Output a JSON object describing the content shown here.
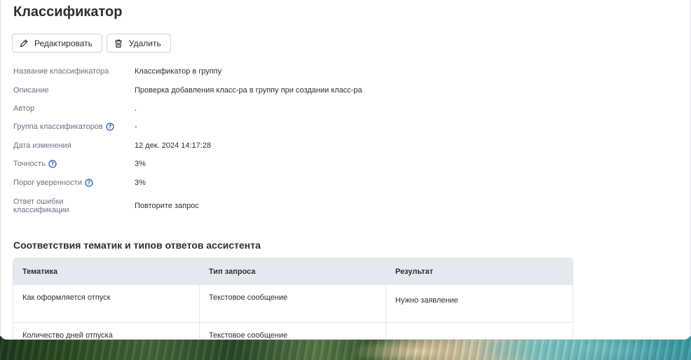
{
  "page": {
    "title": "Классификатор"
  },
  "toolbar": {
    "edit_label": "Редактировать",
    "delete_label": "Удалить"
  },
  "properties": [
    {
      "label": "Название классификатора",
      "value": "Классификатор в группу",
      "help": false
    },
    {
      "label": "Описание",
      "value": "Проверка добавления класс-ра в группу при создании класс-ра",
      "help": false
    },
    {
      "label": "Автор",
      "value": ".",
      "help": false
    },
    {
      "label": "Группа классификаторов",
      "value": "-",
      "help": true
    },
    {
      "label": "Дата изменения",
      "value": "12 дек. 2024 14:17:28",
      "help": false
    },
    {
      "label": "Точность",
      "value": "3%",
      "help": true
    },
    {
      "label": "Порог уверенности",
      "value": "3%",
      "help": true
    },
    {
      "label": "Ответ ошибки классификации",
      "value": "Повторите запрос",
      "help": false
    }
  ],
  "section": {
    "title": "Соответствия тематик и типов ответов ассистента"
  },
  "table": {
    "headers": [
      "Тематика",
      "Тип запроса",
      "Результат"
    ],
    "rows": [
      [
        "Как оформляется отпуск",
        "Текстовое сообщение",
        "Нужно заявление"
      ],
      [
        "Количество дней отпуска",
        "Текстовое сообщение",
        ""
      ]
    ]
  },
  "colors": {
    "header_bg": "#e4e9f0",
    "help_icon": "#2f5fb3",
    "label_text": "#6b7280"
  },
  "icons": {
    "edit": "pencil-icon",
    "delete": "trash-icon",
    "help": "question-circle-icon"
  }
}
